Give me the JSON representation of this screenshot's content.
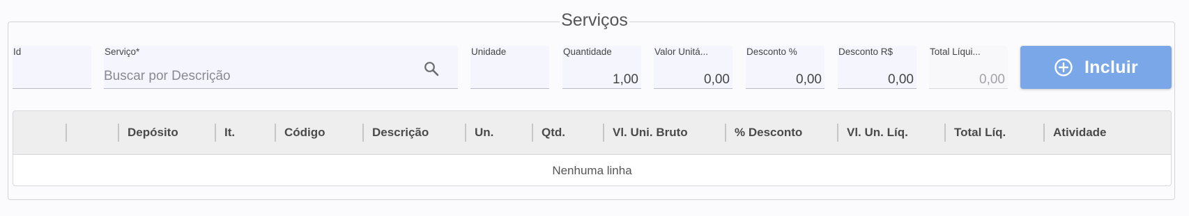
{
  "section": {
    "title": "Serviços"
  },
  "fields": {
    "id": {
      "label": "Id",
      "value": ""
    },
    "servico": {
      "label": "Serviço*",
      "placeholder": "Buscar por Descrição"
    },
    "unidade": {
      "label": "Unidade",
      "value": ""
    },
    "quantidade": {
      "label": "Quantidade",
      "value": "1,00"
    },
    "valor_unitario": {
      "label": "Valor Unitá...",
      "value": "0,00"
    },
    "desconto_pct": {
      "label": "Desconto %",
      "value": "0,00"
    },
    "desconto_rs": {
      "label": "Desconto R$",
      "value": "0,00"
    },
    "total_liquido": {
      "label": "Total Líqui...",
      "value": "0,00"
    }
  },
  "button": {
    "label": "Incluir",
    "icon": "plus-circle-icon",
    "color": "#7aa7e7"
  },
  "grid": {
    "columns": [
      "",
      "",
      "Depósito",
      "It.",
      "Código",
      "Descrição",
      "Un.",
      "Qtd.",
      "Vl. Uni. Bruto",
      "% Desconto",
      "Vl. Un. Líq.",
      "Total Líq.",
      "Atividade"
    ],
    "empty_text": "Nenhuma linha"
  }
}
